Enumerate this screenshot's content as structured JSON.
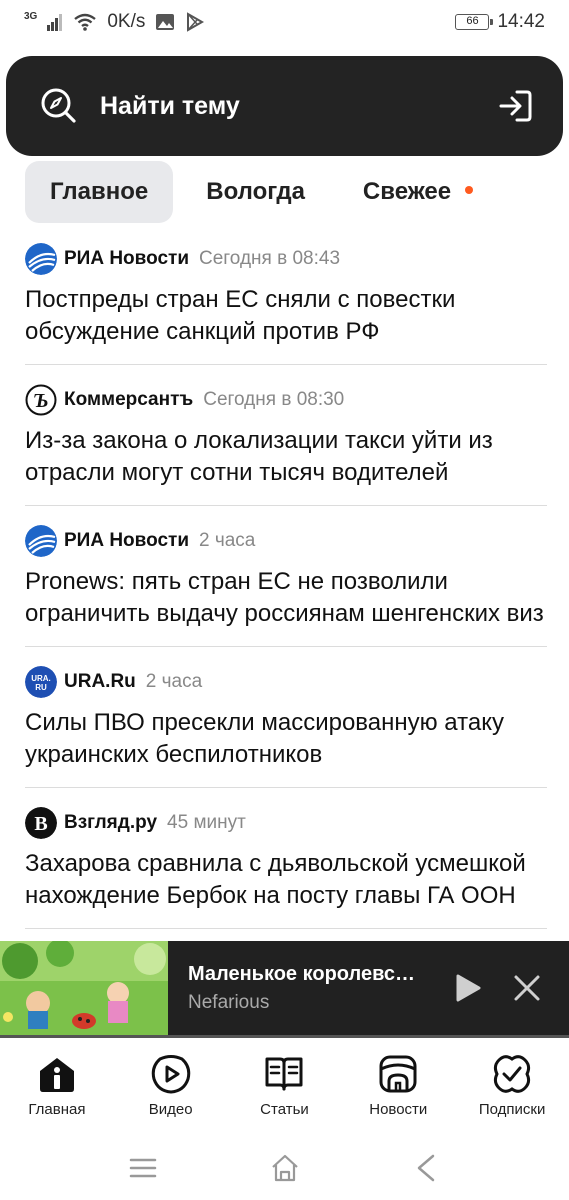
{
  "status_bar": {
    "network": "3G",
    "speed": "0K/s",
    "battery": "66",
    "time": "14:42"
  },
  "search": {
    "placeholder": "Найти тему"
  },
  "tabs": [
    {
      "label": "Главное",
      "active": true
    },
    {
      "label": "Вологда",
      "active": false
    },
    {
      "label": "Свежее",
      "active": false,
      "has_dot": true
    }
  ],
  "feed": [
    {
      "source": "РИА Новости",
      "time": "Сегодня в 08:43",
      "headline": "Постпреды стран ЕС сняли с повестки обсуждение санкций против РФ"
    },
    {
      "source": "Коммерсантъ",
      "time": "Сегодня в 08:30",
      "headline": "Из-за закона о локализации такси уйти из отрасли могут сотни тысяч водителей"
    },
    {
      "source": "РИА Новости",
      "time": "2 часа",
      "headline": "Pronews: пять стран ЕС не позволили ограничить выдачу россиянам шенгенских виз"
    },
    {
      "source": "URA.Ru",
      "time": "2 часа",
      "headline": "Силы ПВО пресекли массированную атаку украинских беспилотников"
    },
    {
      "source": "Взгляд.ру",
      "time": "45 минут",
      "headline": "Захарова сравнила с дьявольской усмешкой нахождение Бербок на посту главы ГА ООН"
    }
  ],
  "player": {
    "title": "Маленькое королевс…",
    "subtitle": "Nefarious"
  },
  "bottom_nav": [
    {
      "label": "Главная",
      "icon": "home-icon"
    },
    {
      "label": "Видео",
      "icon": "video-icon"
    },
    {
      "label": "Статьи",
      "icon": "articles-icon"
    },
    {
      "label": "Новости",
      "icon": "news-icon"
    },
    {
      "label": "Подписки",
      "icon": "subscriptions-icon"
    }
  ],
  "colors": {
    "accent_dot": "#ff5a1f",
    "search_bg": "#232323",
    "player_bg": "#212121"
  }
}
